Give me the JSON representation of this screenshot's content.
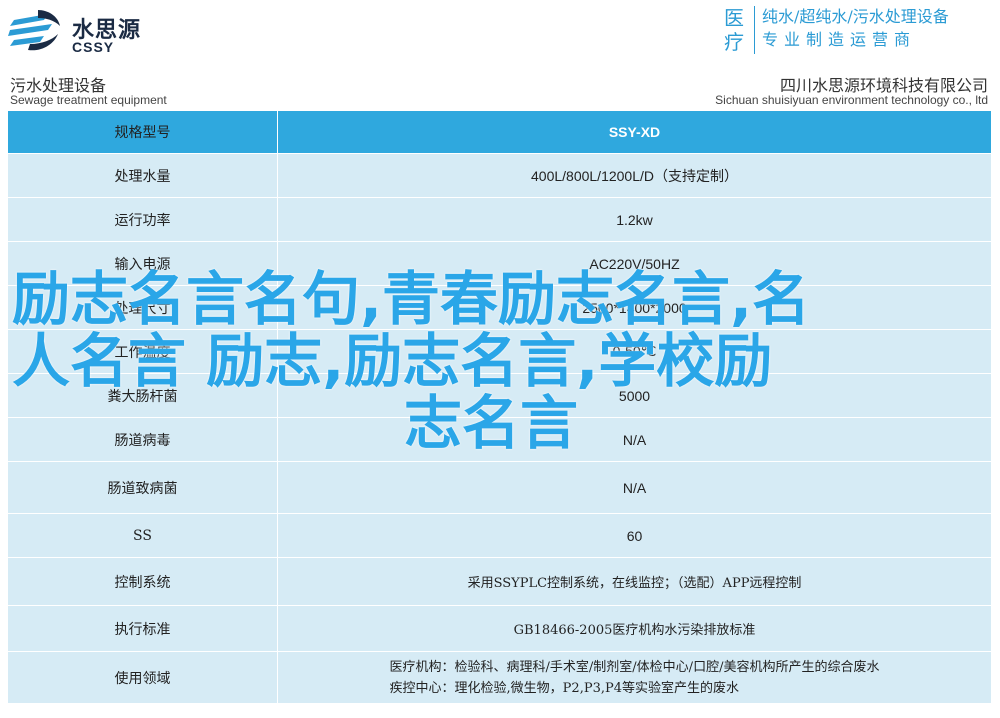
{
  "header": {
    "logo_cn": "水思源",
    "logo_en": "CSSY",
    "medical_chars": [
      "医",
      "疗"
    ],
    "slogan_line1": "纯水/超纯水/污水处理设备",
    "slogan_line2": "专业制造运营商"
  },
  "subheader": {
    "left_cn": "污水处理设备",
    "left_en": "Sewage treatment equipment",
    "right_cn": "四川水思源环境科技有限公司",
    "right_en": "Sichuan shuisiyuan environment technology co., ltd"
  },
  "table": {
    "header": {
      "key": "规格型号",
      "value": "SSY-XD"
    },
    "rows": [
      {
        "key": "处理水量",
        "value": "400L/800L/1200L/D（支持定制）"
      },
      {
        "key": "运行功率",
        "value": "1.2kw"
      },
      {
        "key": "输入电源",
        "value": "AC220V/50HZ"
      },
      {
        "key": "处理尺寸",
        "value": "2500*1400*2000"
      },
      {
        "key": "工作温度",
        "value": "0-50℃"
      },
      {
        "key": "粪大肠杆菌",
        "value": "5000"
      },
      {
        "key": "肠道病毒",
        "value": "N/A"
      },
      {
        "key": "肠道致病菌",
        "value": "N/A"
      },
      {
        "key": "SS",
        "value": "60"
      },
      {
        "key": "控制系统",
        "value": "采用SSYPLC控制系统，在线监控；（选配）APP远程控制"
      },
      {
        "key": "执行标准",
        "value": "GB18466-2005医疗机构水污染排放标准"
      },
      {
        "key": "使用领域",
        "value_lines": [
          "医疗机构：检验科、病理科/手术室/制剂室/体检中心/口腔/美容机构所产生的综合废水",
          "疾控中心：理化检验,微生物，P2,P3,P4等实验室产生的废水"
        ]
      }
    ]
  },
  "overlay": {
    "line1": "励志名言名句,青春励志名言,名",
    "line2": "人名言 励志,励志名言,学校励",
    "line3": "志名言"
  },
  "colors": {
    "accent": "#2fa8de",
    "row_bg": "#d6ebf5",
    "overlay": "#2aa6e8"
  }
}
